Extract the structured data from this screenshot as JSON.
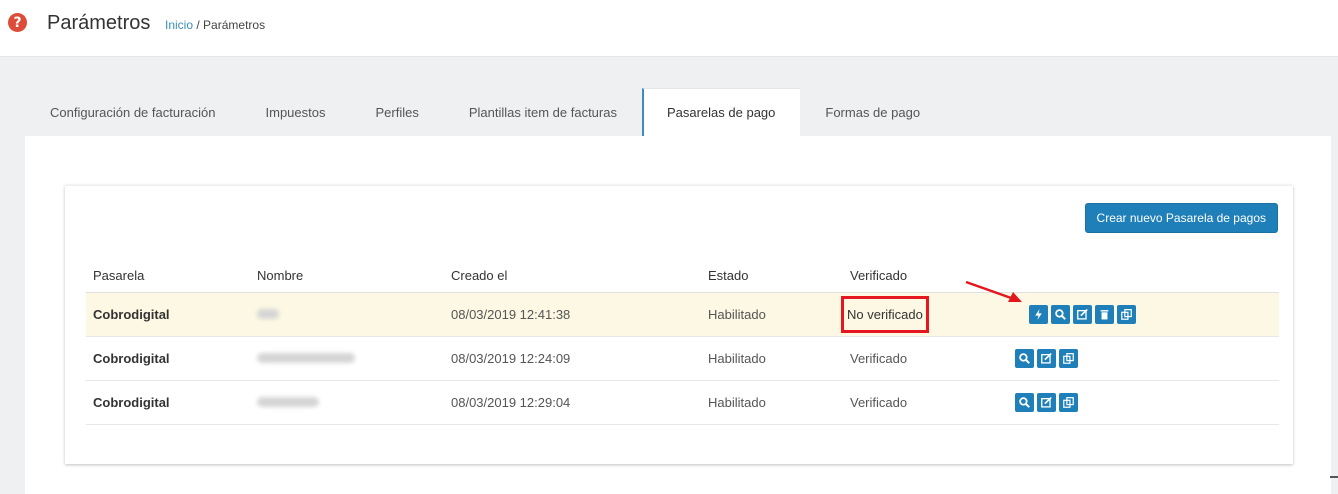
{
  "header": {
    "title": "Parámetros",
    "breadcrumb": {
      "home": "Inicio",
      "separator": "/",
      "current": "Parámetros"
    }
  },
  "tabs": [
    {
      "label": "Configuración de facturación",
      "active": false
    },
    {
      "label": "Impuestos",
      "active": false
    },
    {
      "label": "Perfiles",
      "active": false
    },
    {
      "label": "Plantillas item de facturas",
      "active": false
    },
    {
      "label": "Pasarelas de pago",
      "active": true
    },
    {
      "label": "Formas de pago",
      "active": false
    }
  ],
  "toolbar": {
    "create_label": "Crear nuevo Pasarela de pagos"
  },
  "table": {
    "columns": [
      "Pasarela",
      "Nombre",
      "Creado el",
      "Estado",
      "Verificado",
      ""
    ],
    "rows": [
      {
        "pasarela": "Cobrodigital",
        "creado": "08/03/2019 12:41:38",
        "estado": "Habilitado",
        "verificado": "No verificado",
        "highlight": true,
        "actions": [
          "bolt-icon",
          "search-icon",
          "edit-icon",
          "trash-icon",
          "copy-icon"
        ]
      },
      {
        "pasarela": "Cobrodigital",
        "creado": "08/03/2019 12:24:09",
        "estado": "Habilitado",
        "verificado": "Verificado",
        "highlight": false,
        "actions": [
          "search-icon",
          "edit-icon",
          "copy-icon"
        ]
      },
      {
        "pasarela": "Cobrodigital",
        "creado": "08/03/2019 12:29:04",
        "estado": "Habilitado",
        "verificado": "Verificado",
        "highlight": false,
        "actions": [
          "search-icon",
          "edit-icon",
          "copy-icon"
        ]
      }
    ]
  },
  "colors": {
    "primary": "#1f7fb8",
    "highlight_row": "#fcf8e3",
    "annotation_red": "#e3171d",
    "help_icon": "#dd4b39"
  }
}
